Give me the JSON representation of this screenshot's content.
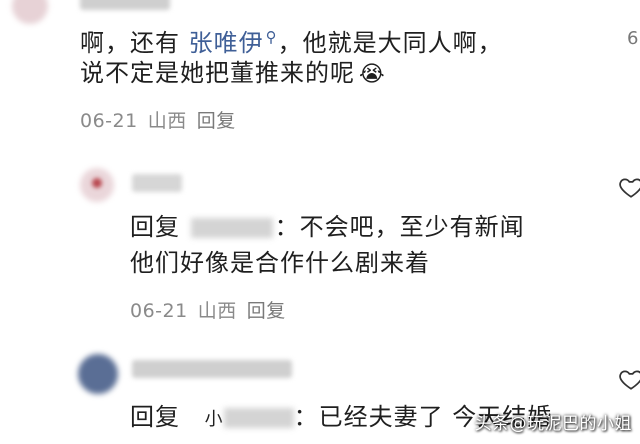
{
  "comment1": {
    "text_before": "啊，还有 ",
    "mention": "张唯伊",
    "text_after": "，他就是大同人啊，",
    "line2": "说不定是她把董推来的呢",
    "emoji": "😭",
    "date": "06-21",
    "location": "山西",
    "reply_label": "回复"
  },
  "edge_char": "6",
  "reply1": {
    "prefix": "回复",
    "text_line1": "：不会吧，至少有新闻",
    "text_line2": "他们好像是合作什么剧来着",
    "date": "06-21",
    "location": "山西",
    "reply_label": "回复"
  },
  "reply2": {
    "prefix": "回复",
    "partial_name": "小",
    "text_line1": "：已经夫妻了 今天结婚"
  },
  "watermark": "头条@玩泥巴的小姐",
  "colors": {
    "mention": "#3f5f97",
    "meta": "#8a8a8a",
    "text": "#1f1f1f"
  }
}
